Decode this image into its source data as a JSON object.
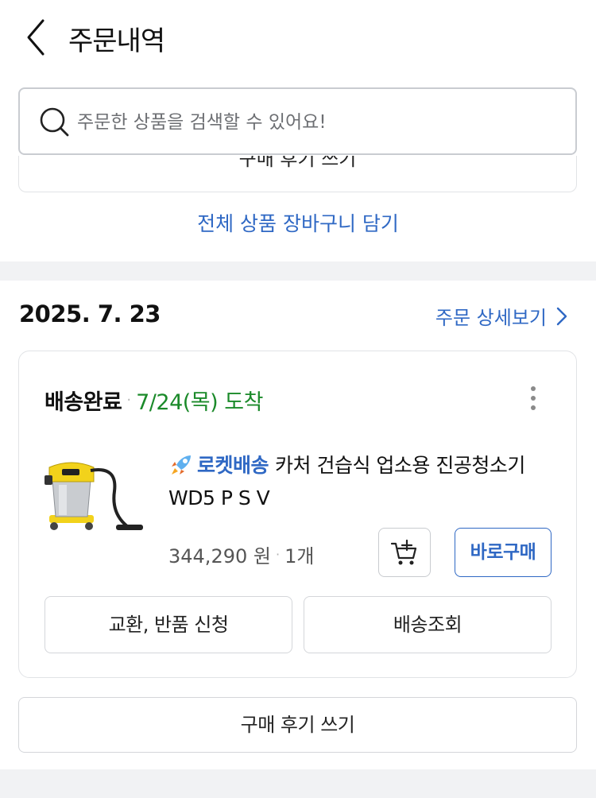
{
  "header": {
    "title": "주문내역",
    "back_icon": "chevron-left-icon"
  },
  "search": {
    "placeholder": "주문한 상품을 검색할 수 있어요!",
    "value": ""
  },
  "previous_order": {
    "partial_button_label": "구매 후기 쓰기",
    "add_all_to_cart_label": "전체 상품 장바구니 담기"
  },
  "order": {
    "date": "2025. 7. 23",
    "detail_link_label": "주문 상세보기",
    "status": "배송완료",
    "arrival": "7/24(목) 도착",
    "item": {
      "rocket_label": "로켓배송",
      "name_line1": "카처 건습식 업소용 진공청소기",
      "name_line2": "WD5 P S V",
      "price": "344,290 원",
      "quantity": "1개",
      "buy_now_label": "바로구매"
    },
    "exchange_label": "교환, 반품 신청",
    "tracking_label": "배송조회",
    "review_label": "구매 후기 쓰기"
  },
  "colors": {
    "accent_blue": "#2f68c4",
    "arrival_green": "#1b8a2a",
    "section_gap": "#f1f2f4"
  }
}
